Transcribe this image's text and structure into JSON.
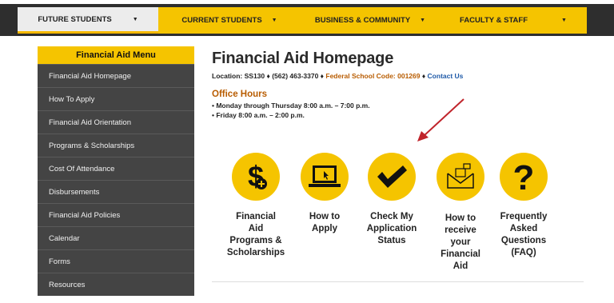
{
  "nav": {
    "items": [
      {
        "label": "FUTURE STUDENTS",
        "caret": "▼"
      },
      {
        "label": "CURRENT STUDENTS",
        "caret": "▼"
      },
      {
        "label": "BUSINESS & COMMUNITY",
        "caret": "▼"
      },
      {
        "label": "FACULTY & STAFF",
        "caret": "▼"
      }
    ]
  },
  "sidebar": {
    "title": "Financial Aid Menu",
    "items": [
      {
        "label": "Financial Aid Homepage"
      },
      {
        "label": "How To Apply"
      },
      {
        "label": "Financial Aid Orientation"
      },
      {
        "label": "Programs & Scholarships"
      },
      {
        "label": "Cost Of Attendance"
      },
      {
        "label": "Disbursements"
      },
      {
        "label": "Financial Aid Policies"
      },
      {
        "label": "Calendar"
      },
      {
        "label": "Forms"
      },
      {
        "label": "Resources"
      }
    ]
  },
  "main": {
    "title": "Financial Aid Homepage",
    "location_prefix": "Location: SS130 ♦ (562) 463-3370 ♦ ",
    "federal_code": "Federal School Code: 001269",
    "separator": " ♦ ",
    "contact_link": "Contact Us",
    "office_hours_title": "Office Hours",
    "hours": [
      "Monday  through Thursday  8:00 a.m. – 7:00 p.m.",
      "Friday 8:00 a.m. – 2:00 p.m."
    ],
    "tiles": [
      {
        "icon": "dollar-icon",
        "label_lines": [
          "Financial",
          "Aid",
          "Programs &",
          "Scholarships"
        ]
      },
      {
        "icon": "laptop-icon",
        "label_lines": [
          "How to",
          "Apply"
        ]
      },
      {
        "icon": "checkmark-icon",
        "label_lines": [
          "Check My",
          "Application",
          "Status"
        ]
      },
      {
        "icon": "envelope-icon",
        "label_lines": [
          "How to",
          "receive",
          "your",
          "Financial",
          "Aid"
        ]
      },
      {
        "icon": "question-icon",
        "label_lines": [
          "Frequently",
          "Asked",
          "Questions",
          "(FAQ)"
        ]
      }
    ]
  },
  "colors": {
    "gold": "#f5c400",
    "sidebar_bg": "#444444",
    "accent_orange": "#b85c00",
    "link_blue": "#1f5aa8"
  }
}
